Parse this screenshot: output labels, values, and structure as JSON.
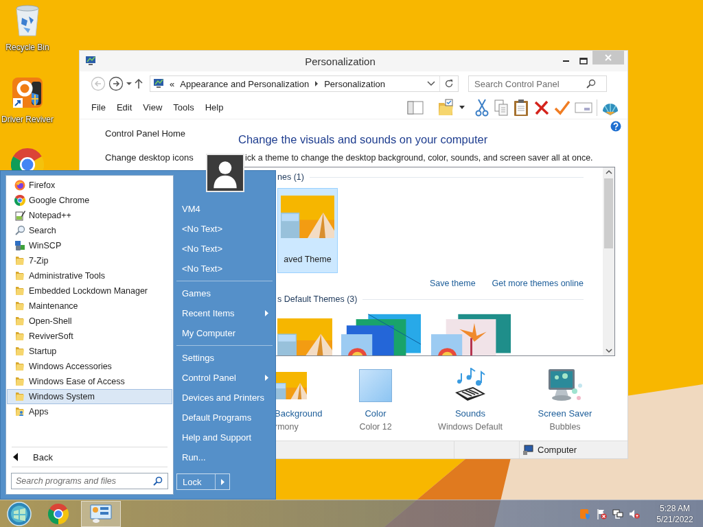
{
  "desktop_icons": [
    {
      "kind": "recycle-bin",
      "label": "Recycle Bin"
    },
    {
      "kind": "reviver",
      "label": "Driver Reviver"
    },
    {
      "kind": "chrome"
    }
  ],
  "window": {
    "title": "Personalization",
    "nav_buttons": [
      {
        "kind": "back",
        "disabled": true
      },
      {
        "kind": "forward",
        "disabled": false
      },
      {
        "kind": "history",
        "disabled": false
      },
      {
        "kind": "up",
        "disabled": false
      }
    ],
    "address": {
      "overflow": "«",
      "crumbs": [
        "Appearance and Personalization",
        "Personalization"
      ]
    },
    "search": {
      "placeholder": "Search Control Panel"
    },
    "menu": [
      "File",
      "Edit",
      "View",
      "Tools",
      "Help"
    ],
    "sidebar": {
      "links": [
        "Control Panel Home",
        "Change desktop icons"
      ]
    },
    "heading": "Change the visuals and sounds on your computer",
    "subtitle": "ick a theme to change the desktop background, color, sounds, and screen saver all at once.",
    "theme_groups": [
      {
        "title": "nes (1)",
        "themes": [
          {
            "kind": "harmony",
            "name": "aved Theme",
            "selected": true
          }
        ],
        "links": [
          "Save theme",
          "Get more themes online"
        ]
      },
      {
        "title": "s Default Themes (3)",
        "themes": [
          {
            "kind": "harmony",
            "selected": false
          },
          {
            "kind": "lines",
            "selected": false
          },
          {
            "kind": "flowers",
            "selected": false
          }
        ]
      }
    ],
    "settings": [
      {
        "kind": "background",
        "label": "Background",
        "value": "rmony"
      },
      {
        "kind": "color",
        "label": "Color",
        "value": "Color 12"
      },
      {
        "kind": "sounds",
        "label": "Sounds",
        "value": "Windows Default"
      },
      {
        "kind": "screensaver",
        "label": "Screen Saver",
        "value": "Bubbles"
      }
    ],
    "status_bar": {
      "location": "Computer"
    }
  },
  "start_menu": {
    "programs": [
      {
        "kind": "firefox",
        "label": "Firefox",
        "selected": false
      },
      {
        "kind": "chrome",
        "label": "Google Chrome",
        "selected": false
      },
      {
        "kind": "notepad",
        "label": "Notepad++",
        "selected": false
      },
      {
        "kind": "search",
        "label": "Search",
        "selected": false
      },
      {
        "kind": "winscp",
        "label": "WinSCP",
        "selected": false
      },
      {
        "kind": "folder",
        "label": "7-Zip",
        "selected": false
      },
      {
        "kind": "folder",
        "label": "Administrative Tools",
        "selected": false
      },
      {
        "kind": "folder",
        "label": "Embedded Lockdown Manager",
        "selected": false
      },
      {
        "kind": "folder",
        "label": "Maintenance",
        "selected": false
      },
      {
        "kind": "folder",
        "label": "Open-Shell",
        "selected": false
      },
      {
        "kind": "folder",
        "label": "ReviverSoft",
        "selected": false
      },
      {
        "kind": "folder",
        "label": "Startup",
        "selected": false
      },
      {
        "kind": "folder",
        "label": "Windows Accessories",
        "selected": false
      },
      {
        "kind": "folder",
        "label": "Windows Ease of Access",
        "selected": false
      },
      {
        "kind": "folder",
        "label": "Windows System",
        "selected": true
      },
      {
        "kind": "apps",
        "label": "Apps",
        "selected": false
      }
    ],
    "back": "Back",
    "search": {
      "placeholder": "Search programs and files"
    },
    "place_groups": [
      [
        {
          "label": "VM4",
          "submenu": false
        },
        {
          "label": "<No Text>",
          "submenu": false
        },
        {
          "label": "<No Text>",
          "submenu": false
        },
        {
          "label": "<No Text>",
          "submenu": false
        }
      ],
      [
        {
          "label": "Games",
          "submenu": false
        },
        {
          "label": "Recent Items",
          "submenu": true
        },
        {
          "label": "My Computer",
          "submenu": false
        }
      ],
      [
        {
          "label": "Settings",
          "submenu": false
        },
        {
          "label": "Control Panel",
          "submenu": true
        },
        {
          "label": "Devices and Printers",
          "submenu": false
        },
        {
          "label": "Default Programs",
          "submenu": false
        },
        {
          "label": "Help and Support",
          "submenu": false
        },
        {
          "label": "Run...",
          "submenu": false
        }
      ]
    ],
    "lock": "Lock"
  },
  "taskbar": {
    "buttons": [
      {
        "kind": "start",
        "active": false
      },
      {
        "kind": "chrome",
        "active": false
      },
      {
        "kind": "control-panel",
        "active": true
      }
    ],
    "tray": [
      {
        "kind": "reviver"
      },
      {
        "kind": "flag"
      },
      {
        "kind": "network"
      },
      {
        "kind": "volume-muted"
      }
    ],
    "time": "5:28 AM",
    "date": "5/21/2022"
  }
}
